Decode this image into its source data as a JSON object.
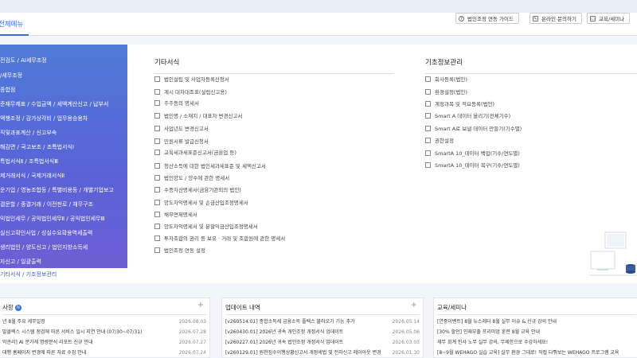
{
  "header": {
    "all_menu": "전체메뉴",
    "buttons": [
      {
        "label": "법인조정 연동 가이드",
        "icon": "help-icon"
      },
      {
        "label": "온라인 문의하기",
        "icon": "pencil-icon"
      },
      {
        "label": "교육/세미나",
        "icon": "book-icon"
      }
    ]
  },
  "sidebar": {
    "items": [
      "전검도 / AI세무조정",
      "/세무조정",
      "종합점",
      "준재무제표 / 수입금액 / 세액계산신고 / 납부서",
      "액행조정 / 감가상각비 / 업무용승용차",
      "직및과표계산 / 신고부속",
      "해감면 / 국고보조 / 조특법서식Ⅰ",
      "특법서식Ⅱ / 조특법서식Ⅲ",
      "제거래서식 / 국제거래서식Ⅱ",
      "운기업 / 영농조합등 / 특별비용등 / 개별기업보고",
      "결문할 / 종결거래 / 이전판로 / 채무구조",
      "익법인세무 / 공익법인세무Ⅱ / 공익법인세무Ⅲ",
      "실신고확인사업 / 성실수요확용역세출력",
      "생리법인 / 양도신고 / 법인지방소득세",
      "자신고 / 일괄출력",
      "기타서식 / 기조정보관리"
    ],
    "active_index": 15
  },
  "misc_forms": {
    "title": "기타서식",
    "links": [
      "법인설립 및 사업자등록신청서",
      "계시 대차대조표(설립신고용)",
      "주주등의 명세서",
      "법인명 / 소재지 / 대표자 변경신고서",
      "사업년도 변경신고서",
      "민원서류 발급신청서",
      "교육세과세표준신고서(금융업 등)",
      "청산소득에 대한 법인세과세표준 및 세액신고서",
      "법인양도 / 양수에 관한 명세서",
      "수증자산명세서(금융기관외의 법인)",
      "양도차익명세서 및 손금산입조정명세서",
      "채무면제명세서",
      "양도차익명세서 및 분할익금산입조정명세서",
      "투자조합의 권리 등 보유 · 거래 및 조합원에 관한 명세서",
      "법인조정 연동 설정"
    ]
  },
  "basic_info": {
    "title": "기초정보관리",
    "links": [
      "회사등록(법인)",
      "환경설정(법인)",
      "계정과목 및 적요등록(법인)",
      "Smart A 데이터 올리기(전체기수)",
      "Smart A로 보낼 데이터 만들기(기수별)",
      "권한설정",
      "SmartA 10_데이터 백업(기수/연도별)",
      "SmartA 10_데이터 복구(기수/연도별)"
    ]
  },
  "notices": {
    "title": "사항",
    "badge": "N",
    "rows": [
      {
        "text": "년 8월 주요 세무일정",
        "date": "2026.08.03"
      },
      {
        "text": "발클렉스 시스템 점검에 따른 서비스 일시 지연 안내 (07/30~07/31)",
        "date": "2026.07.28"
      },
      {
        "text": "막관리] AI 분가세 명량분석 리포트 신규 안내",
        "date": "2026.07.27"
      },
      {
        "text": "대행 홈페이지 변경에 따른 자료 수집 안내",
        "date": "2026.07.24"
      }
    ]
  },
  "updates": {
    "title": "업데이트 내역",
    "rows": [
      {
        "text": "[v260514.01] 종합소득세 금융소득 플렉스 불러오기 기능 추가",
        "date": "2026.05.14"
      },
      {
        "text": "[v260430.01] 2026년 귀속 개인조정 개정서식 업데이트",
        "date": "2026.05.06"
      },
      {
        "text": "[v260227.01] 2026년 귀속 법인조정 개정서식 업데이트",
        "date": "2026.03.03"
      },
      {
        "text": "[v260129.01] 원천징수이행상황신고서 개정세법 및 전자신고 레이아웃 변경",
        "date": "2026.01.30"
      }
    ]
  },
  "education": {
    "title": "교육/세미나",
    "rows": [
      {
        "text": "[연중이벤트] 8월 뉴스레터 8월 실무 이슈 & 신규 강의 안내"
      },
      {
        "text": "[30% 할인] 인재부출 프리미엄 훈련 8월 교육 안내"
      },
      {
        "text": "세무 회계 인사 노무 실무 강의, 무제한으로 수강하세요!"
      },
      {
        "text": "[8~9월 WEHAGO 실습 교육] 실무 환경 그대로! 직접 다뤄보는 WEHAGO 프로그램 교육"
      }
    ]
  }
}
